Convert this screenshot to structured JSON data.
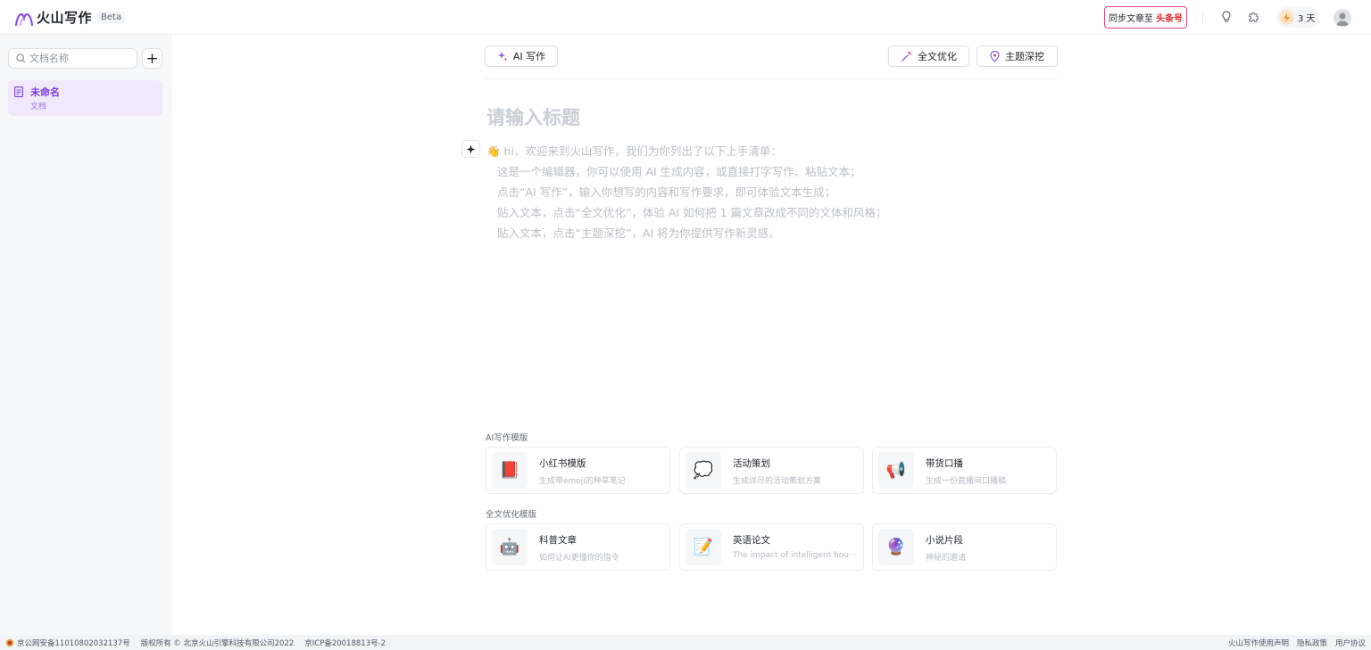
{
  "header": {
    "app_name": "火山写作",
    "beta_label": "Beta",
    "sync_label": "同步文章至",
    "sync_brand": "头条号",
    "energy_count": "3 天"
  },
  "sidebar": {
    "search_placeholder": "文档名称",
    "add_label": "+",
    "documents": [
      {
        "title": "未命名",
        "type": "文档"
      }
    ]
  },
  "toolbar": {
    "ai_write": "AI 写作",
    "optimize": "全文优化",
    "topic_dig": "主题深挖"
  },
  "editor": {
    "title_placeholder": "请输入标题",
    "intro_lines": [
      "👋 hi，欢迎来到火山写作，我们为你列出了以下上手清单：",
      "这是一个编辑器，你可以使用 AI 生成内容，或直接打字写作、粘贴文本；",
      "点击“AI 写作”，输入你想写的内容和写作要求，即可体验文本生成；",
      "贴入文本，点击“全文优化”，体验 AI 如何把 1 篇文章改成不同的文体和风格；",
      "贴入文本，点击“主题深挖”，AI 将为你提供写作新灵感。"
    ]
  },
  "templates": {
    "ai_section_label": "AI写作模版",
    "ai_cards": [
      {
        "icon": "📕",
        "title": "小红书模版",
        "subtitle": "生成带emoji的种草笔记"
      },
      {
        "icon": "💭",
        "title": "活动策划",
        "subtitle": "生成详尽的活动策划方案"
      },
      {
        "icon": "📢",
        "title": "带货口播",
        "subtitle": "生成一份直播间口播稿"
      }
    ],
    "opt_section_label": "全文优化模版",
    "opt_cards": [
      {
        "icon": "🤖",
        "title": "科普文章",
        "subtitle": "如何让AI更懂你的指令"
      },
      {
        "icon": "📝",
        "title": "英语论文",
        "subtitle": "The impact of intelligent hou···"
      },
      {
        "icon": "🔮",
        "title": "小说片段",
        "subtitle": "神秘的邀请"
      }
    ]
  },
  "footer": {
    "police_record": "京公网安备11010802032137号",
    "copyright": "版权所有 © 北京火山引擎科技有限公司2022",
    "icp": "京ICP备20018813号-2",
    "terms": "火山写作使用声明",
    "privacy": "隐私政策",
    "user_agreement": "用户协议"
  },
  "colors": {
    "accent_purple": "#7a3ddc",
    "sidebar_selected_bg": "#f1e9fb",
    "sync_border": "#e6467c"
  }
}
